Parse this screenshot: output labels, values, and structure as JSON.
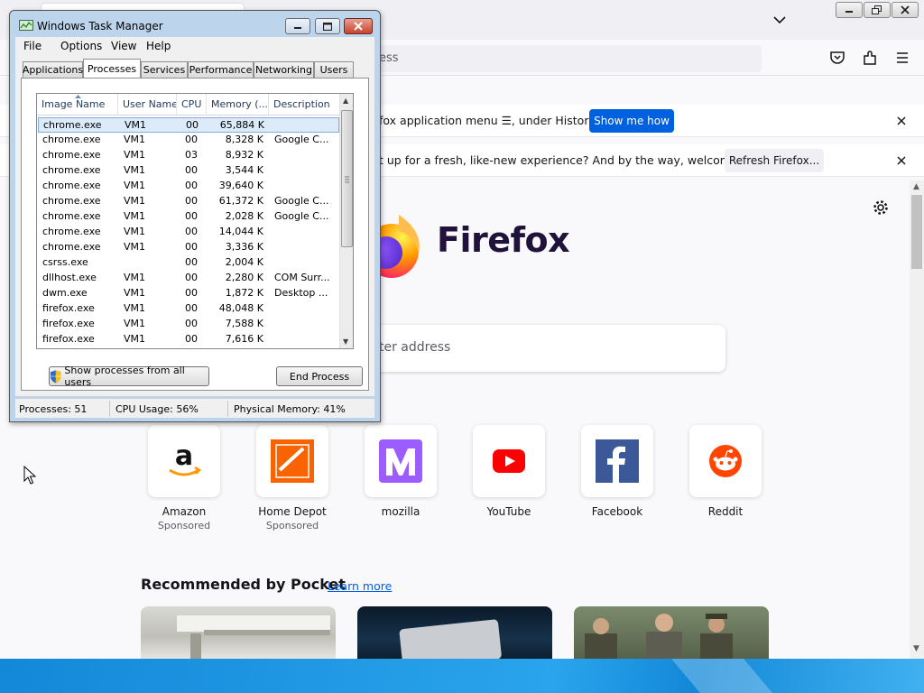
{
  "firefox": {
    "url_placeholder_fragment": "ess",
    "infobar1": {
      "text": "fox application menu ☰, under History.",
      "button": "Show me how"
    },
    "infobar2": {
      "text": "t up for a fresh, like-new experience? And by the way, welcome back!",
      "button": "Refresh Firefox..."
    },
    "wordmark": "Firefox",
    "search_placeholder": "ter address",
    "shortcuts": [
      {
        "name": "Amazon",
        "sponsored": "Sponsored",
        "icon": "amazon-icon"
      },
      {
        "name": "Home Depot",
        "sponsored": "Sponsored",
        "icon": "home-depot-icon"
      },
      {
        "name": "mozilla",
        "sponsored": "",
        "icon": "mozilla-icon"
      },
      {
        "name": "YouTube",
        "sponsored": "",
        "icon": "youtube-icon"
      },
      {
        "name": "Facebook",
        "sponsored": "",
        "icon": "facebook-icon"
      },
      {
        "name": "Reddit",
        "sponsored": "",
        "icon": "reddit-icon"
      }
    ],
    "pocket": {
      "title": "Recommended by Pocket",
      "learn_more": "Learn more"
    },
    "colors": {
      "accent": "#0061e0",
      "wordmark": "#20123a"
    }
  },
  "taskmanager": {
    "title": "Windows Task Manager",
    "menu": [
      "File",
      "Options",
      "View",
      "Help"
    ],
    "tabs": [
      "Applications",
      "Processes",
      "Services",
      "Performance",
      "Networking",
      "Users"
    ],
    "active_tab": "Processes",
    "columns": [
      "Image Name",
      "User Name",
      "CPU",
      "Memory (...",
      "Description"
    ],
    "rows": [
      [
        "chrome.exe",
        "VM1",
        "00",
        "65,884 K",
        ""
      ],
      [
        "chrome.exe",
        "VM1",
        "00",
        "8,328 K",
        "Google C..."
      ],
      [
        "chrome.exe",
        "VM1",
        "03",
        "8,932 K",
        ""
      ],
      [
        "chrome.exe",
        "VM1",
        "00",
        "3,544 K",
        ""
      ],
      [
        "chrome.exe",
        "VM1",
        "00",
        "39,640 K",
        ""
      ],
      [
        "chrome.exe",
        "VM1",
        "00",
        "61,372 K",
        "Google C..."
      ],
      [
        "chrome.exe",
        "VM1",
        "00",
        "2,028 K",
        "Google C..."
      ],
      [
        "chrome.exe",
        "VM1",
        "00",
        "14,044 K",
        ""
      ],
      [
        "chrome.exe",
        "VM1",
        "00",
        "3,336 K",
        ""
      ],
      [
        "csrss.exe",
        "",
        "00",
        "2,004 K",
        ""
      ],
      [
        "dllhost.exe",
        "VM1",
        "00",
        "2,280 K",
        "COM Surr..."
      ],
      [
        "dwm.exe",
        "VM1",
        "00",
        "1,872 K",
        "Desktop ..."
      ],
      [
        "firefox.exe",
        "VM1",
        "00",
        "48,048 K",
        ""
      ],
      [
        "firefox.exe",
        "VM1",
        "00",
        "7,588 K",
        ""
      ],
      [
        "firefox.exe",
        "VM1",
        "00",
        "7,616 K",
        ""
      ]
    ],
    "selected_row": 0,
    "show_all_button": "Show processes from all users",
    "end_process_button": "End Process",
    "status": {
      "processes": "Processes: 51",
      "cpu": "CPU Usage: 56%",
      "memory": "Physical Memory: 41%"
    }
  }
}
